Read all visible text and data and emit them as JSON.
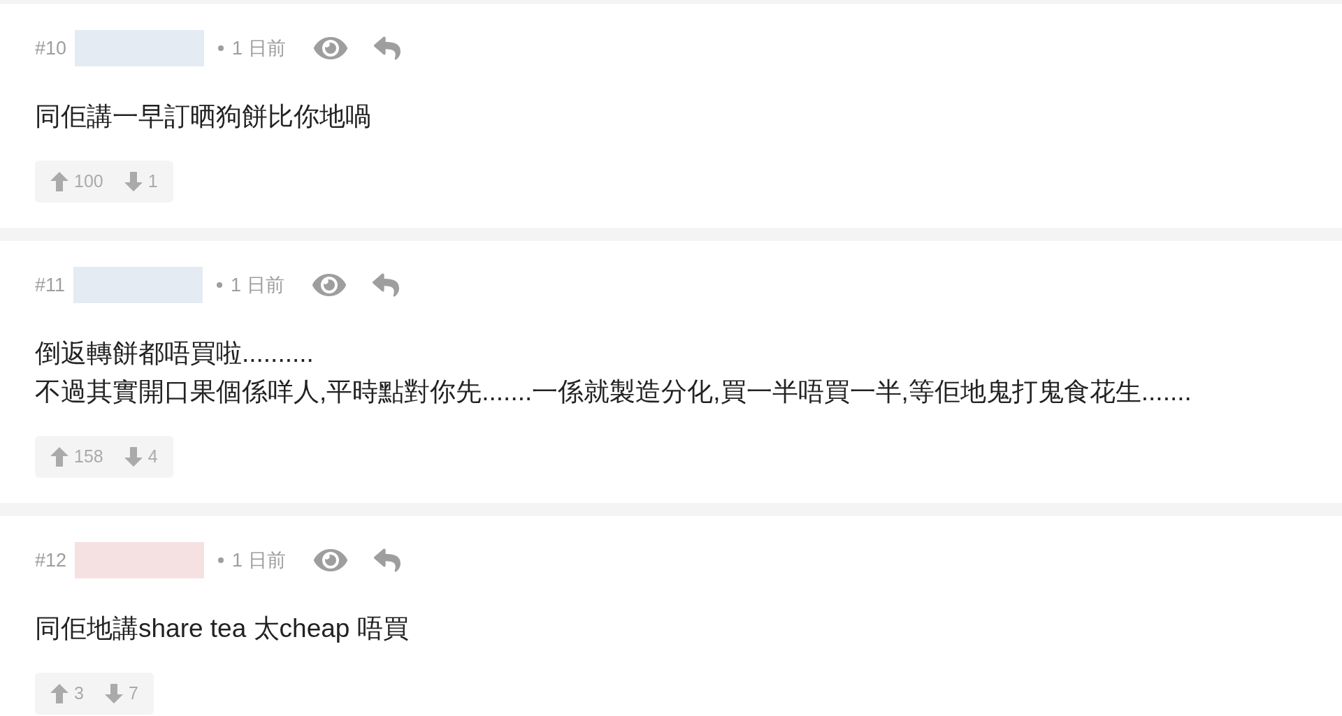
{
  "posts": [
    {
      "number": "#10",
      "color": "#e4ebf3",
      "time": "1 日前",
      "lines": [
        "同佢講一早訂晒狗餅比你地喎"
      ],
      "upvotes": "100",
      "downvotes": "1"
    },
    {
      "number": "#11",
      "color": "#e4ebf3",
      "time": "1 日前",
      "lines": [
        "倒返轉餅都唔買啦..........",
        "不過其實開口果個係咩人,平時點對你先.......一係就製造分化,買一半唔買一半,等佢地鬼打鬼食花生......."
      ],
      "upvotes": "158",
      "downvotes": "4"
    },
    {
      "number": "#12",
      "color": "#f5e0e2",
      "time": "1 日前",
      "lines": [
        "同佢地講share tea 太cheap 唔買"
      ],
      "upvotes": "3",
      "downvotes": "7"
    }
  ]
}
